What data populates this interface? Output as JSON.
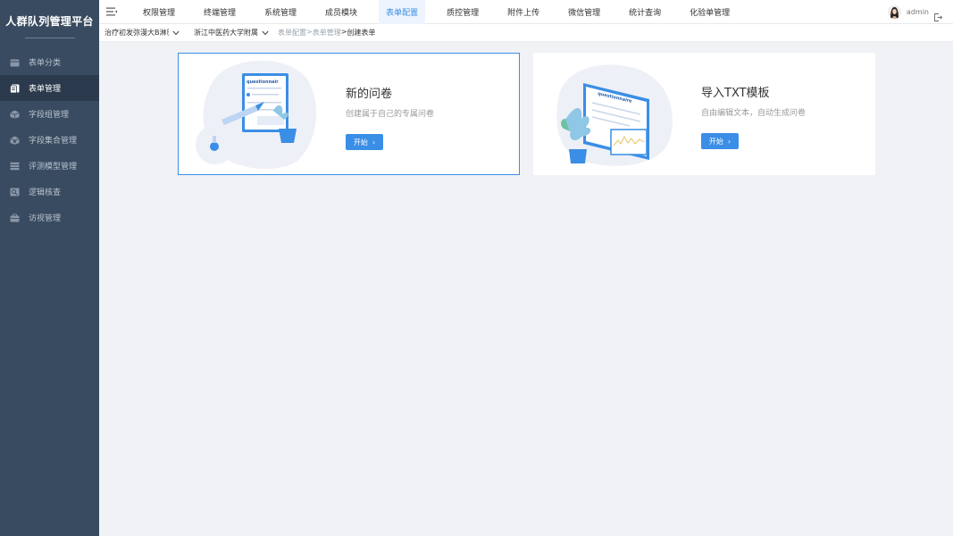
{
  "app": {
    "title": "人群队列管理平台"
  },
  "sidebar": {
    "items": [
      {
        "label": "表单分类",
        "icon": "folder-icon",
        "active": false
      },
      {
        "label": "表单管理",
        "icon": "form-icon",
        "active": true
      },
      {
        "label": "字段组管理",
        "icon": "cube-icon",
        "active": false
      },
      {
        "label": "字段集合管理",
        "icon": "cube-set-icon",
        "active": false
      },
      {
        "label": "评测模型管理",
        "icon": "model-icon",
        "active": false
      },
      {
        "label": "逻辑核查",
        "icon": "logic-check-icon",
        "active": false
      },
      {
        "label": "访视管理",
        "icon": "visit-icon",
        "active": false
      }
    ]
  },
  "topnav": {
    "items": [
      {
        "label": "权限管理",
        "active": false
      },
      {
        "label": "终端管理",
        "active": false
      },
      {
        "label": "系统管理",
        "active": false
      },
      {
        "label": "成员模块",
        "active": false
      },
      {
        "label": "表单配置",
        "active": true
      },
      {
        "label": "质控管理",
        "active": false
      },
      {
        "label": "附件上传",
        "active": false
      },
      {
        "label": "微信管理",
        "active": false
      },
      {
        "label": "统计查询",
        "active": false
      },
      {
        "label": "化验单管理",
        "active": false
      }
    ],
    "user": "admin"
  },
  "subbar": {
    "project_select": "治疗初发弥漫大B淋巴",
    "hospital_select": "浙江中医药大学附属第",
    "breadcrumb": [
      "表单配置",
      ">",
      "表单管理",
      ">",
      "创建表单"
    ]
  },
  "cards": [
    {
      "title": "新的问卷",
      "desc": "创建属于自己的专属问卷",
      "button": "开始",
      "illus_text": "questionnair"
    },
    {
      "title": "导入TXT模板",
      "desc": "自由编辑文本，自动生成问卷",
      "button": "开始",
      "illus_text": "questionnaire"
    }
  ],
  "colors": {
    "sidebar": "#394b60",
    "sidebar_active": "#2b3a4c",
    "accent": "#3a8ee6"
  }
}
